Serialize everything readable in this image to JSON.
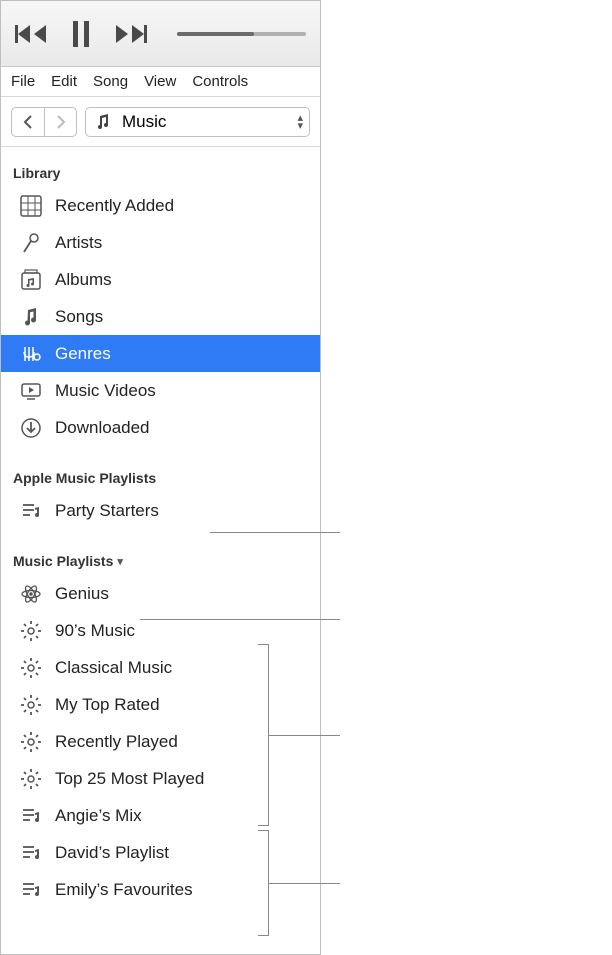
{
  "menubar": [
    "File",
    "Edit",
    "Song",
    "View",
    "Controls"
  ],
  "mediaPicker": {
    "label": "Music"
  },
  "sections": {
    "library": {
      "header": "Library",
      "items": [
        {
          "name": "recently-added",
          "label": "Recently Added",
          "icon": "grid"
        },
        {
          "name": "artists",
          "label": "Artists",
          "icon": "mic"
        },
        {
          "name": "albums",
          "label": "Albums",
          "icon": "album"
        },
        {
          "name": "songs",
          "label": "Songs",
          "icon": "note"
        },
        {
          "name": "genres",
          "label": "Genres",
          "icon": "guitar",
          "selected": true
        },
        {
          "name": "music-videos",
          "label": "Music Videos",
          "icon": "tv"
        },
        {
          "name": "downloaded",
          "label": "Downloaded",
          "icon": "download"
        }
      ]
    },
    "appleMusic": {
      "header": "Apple Music Playlists",
      "items": [
        {
          "name": "party-starters",
          "label": "Party Starters",
          "icon": "playlist"
        }
      ]
    },
    "musicPlaylists": {
      "header": "Music Playlists",
      "items": [
        {
          "name": "genius",
          "label": "Genius",
          "icon": "atom"
        },
        {
          "name": "90s-music",
          "label": "90’s Music",
          "icon": "gear"
        },
        {
          "name": "classical-music",
          "label": "Classical Music",
          "icon": "gear"
        },
        {
          "name": "my-top-rated",
          "label": "My Top Rated",
          "icon": "gear"
        },
        {
          "name": "recently-played",
          "label": "Recently Played",
          "icon": "gear"
        },
        {
          "name": "top-25-most-played",
          "label": "Top 25 Most Played",
          "icon": "gear"
        },
        {
          "name": "angies-mix",
          "label": "Angie’s Mix",
          "icon": "playlist"
        },
        {
          "name": "davids-playlist",
          "label": "David’s Playlist",
          "icon": "playlist"
        },
        {
          "name": "emilys-favourites",
          "label": "Emily’s Favourites",
          "icon": "playlist"
        }
      ]
    }
  }
}
